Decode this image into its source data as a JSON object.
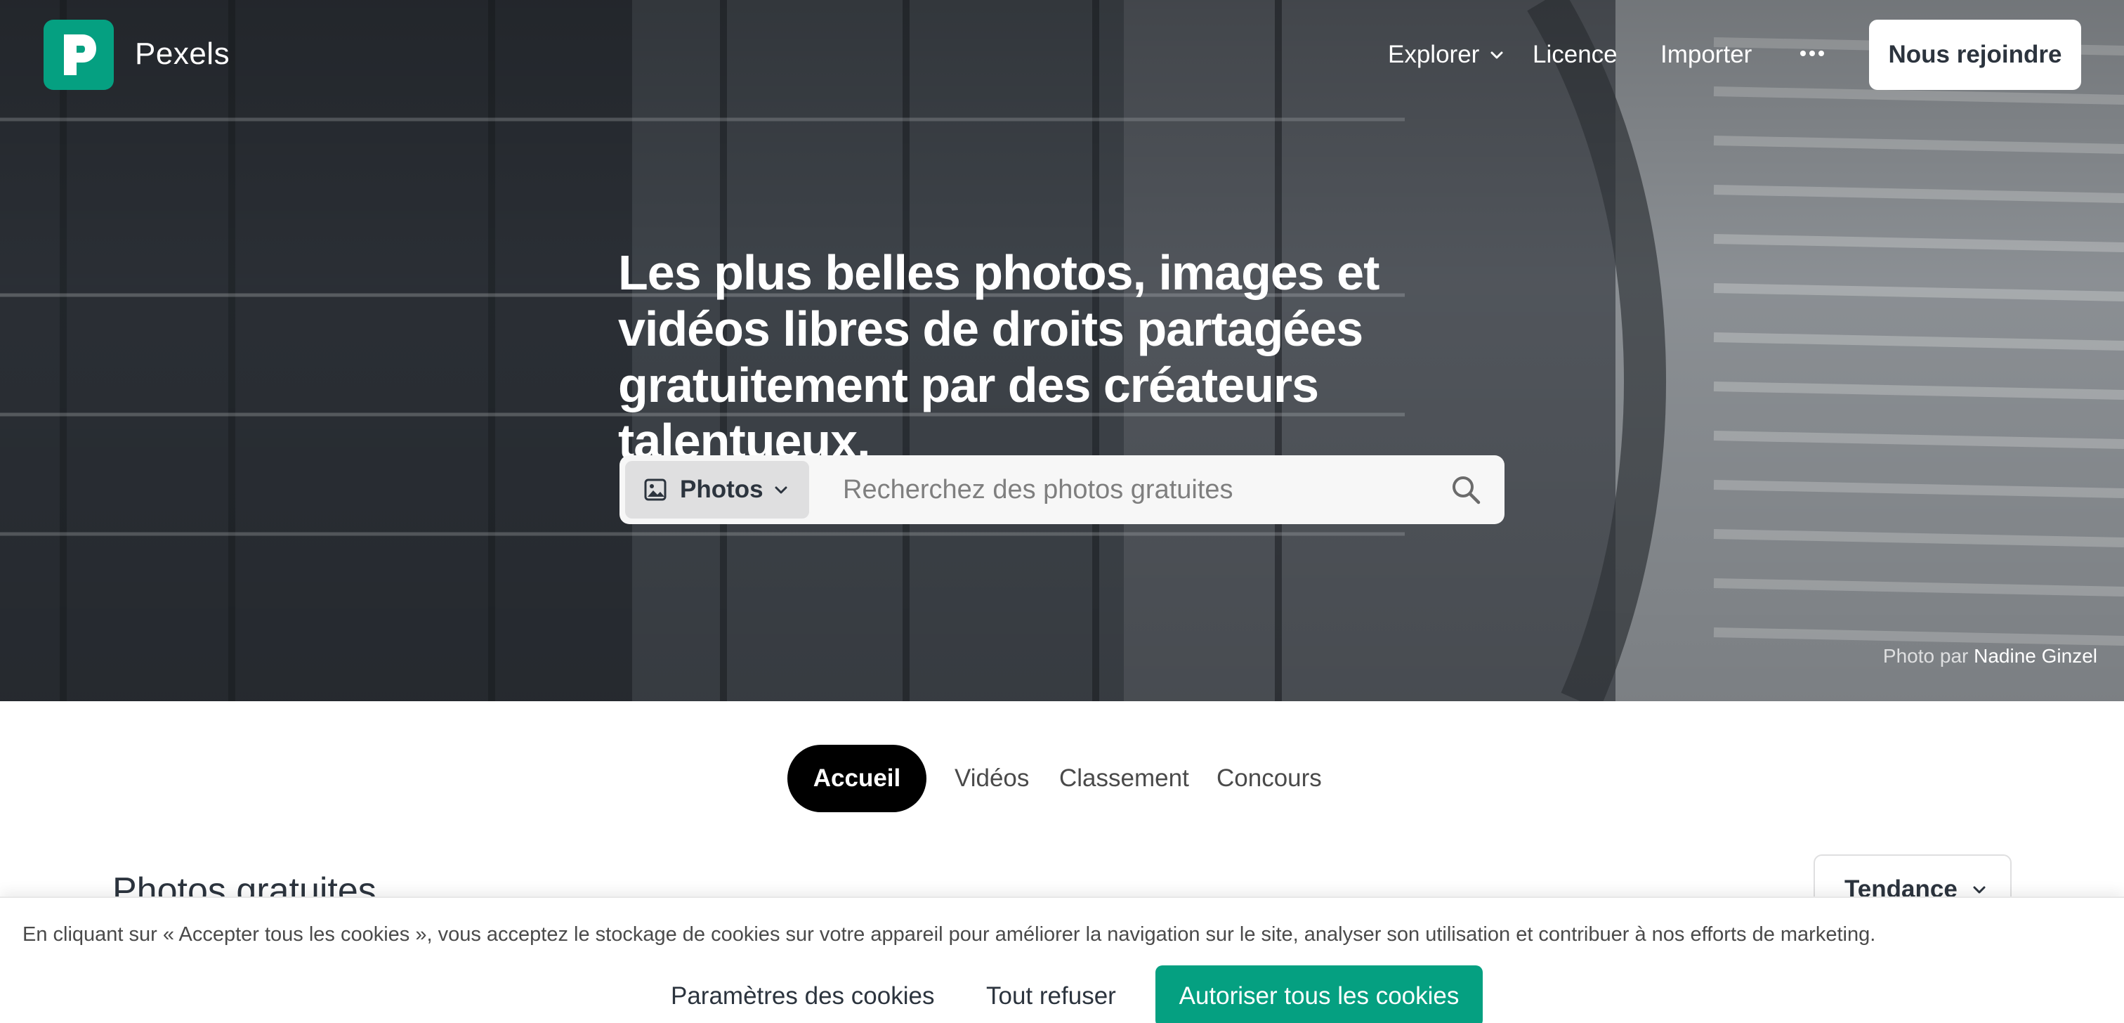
{
  "nav": {
    "brand": "Pexels",
    "links": {
      "explorer": "Explorer",
      "licence": "Licence",
      "importer": "Importer"
    },
    "join_button": "Nous rejoindre"
  },
  "hero": {
    "title": "Les plus belles photos, images et vidéos libres de droits partagées gratuitement par des créateurs talentueux.",
    "credit_prefix": "Photo par",
    "credit_author": "Nadine Ginzel"
  },
  "search": {
    "type_label": "Photos",
    "placeholder": "Recherchez des photos gratuites"
  },
  "tabs": {
    "accueil": "Accueil",
    "videos": "Vidéos",
    "classement": "Classement",
    "concours": "Concours"
  },
  "section": {
    "title": "Photos gratuites",
    "sort_value": "Tendance"
  },
  "cookie": {
    "text": "En cliquant sur « Accepter tous les cookies », vous acceptez le stockage de cookies sur votre appareil pour améliorer la navigation sur le site, analyser son utilisation et contribuer à nos efforts de marketing.",
    "params_label": "Paramètres des cookies",
    "refuse_label": "Tout refuser",
    "accept_label": "Autoriser tous les cookies"
  },
  "icons": {
    "brand_color": "#05a081",
    "logo": "pexels-logo-icon",
    "explorer_chevron": "chevron-down-icon",
    "more": "more-horizontal-icon",
    "photo_type": "image-icon",
    "type_chevron": "chevron-down-icon",
    "search": "search-icon",
    "sort_chevron": "chevron-down-icon"
  }
}
